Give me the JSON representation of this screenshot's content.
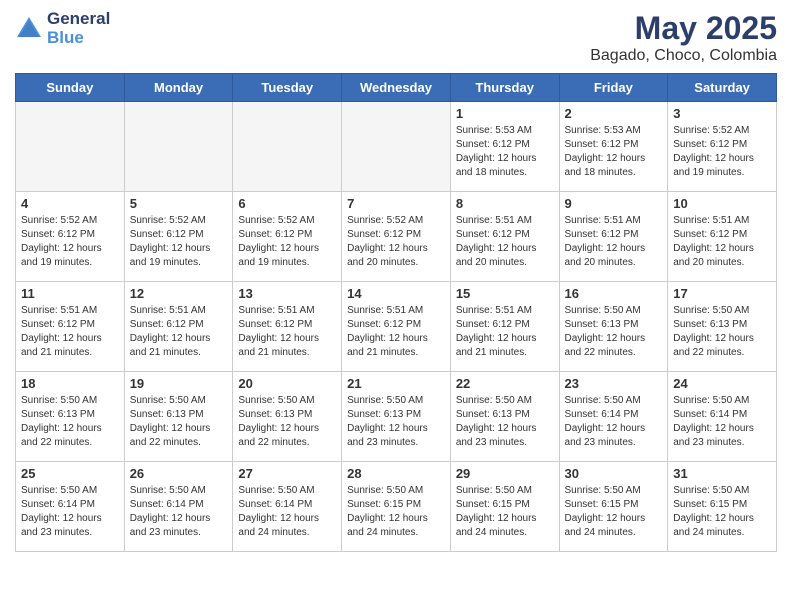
{
  "header": {
    "logo_line1": "General",
    "logo_line2": "Blue",
    "title": "May 2025",
    "subtitle": "Bagado, Choco, Colombia"
  },
  "weekdays": [
    "Sunday",
    "Monday",
    "Tuesday",
    "Wednesday",
    "Thursday",
    "Friday",
    "Saturday"
  ],
  "weeks": [
    [
      {
        "day": "",
        "info": ""
      },
      {
        "day": "",
        "info": ""
      },
      {
        "day": "",
        "info": ""
      },
      {
        "day": "",
        "info": ""
      },
      {
        "day": "1",
        "info": "Sunrise: 5:53 AM\nSunset: 6:12 PM\nDaylight: 12 hours and 18 minutes."
      },
      {
        "day": "2",
        "info": "Sunrise: 5:53 AM\nSunset: 6:12 PM\nDaylight: 12 hours and 18 minutes."
      },
      {
        "day": "3",
        "info": "Sunrise: 5:52 AM\nSunset: 6:12 PM\nDaylight: 12 hours and 19 minutes."
      }
    ],
    [
      {
        "day": "4",
        "info": "Sunrise: 5:52 AM\nSunset: 6:12 PM\nDaylight: 12 hours and 19 minutes."
      },
      {
        "day": "5",
        "info": "Sunrise: 5:52 AM\nSunset: 6:12 PM\nDaylight: 12 hours and 19 minutes."
      },
      {
        "day": "6",
        "info": "Sunrise: 5:52 AM\nSunset: 6:12 PM\nDaylight: 12 hours and 19 minutes."
      },
      {
        "day": "7",
        "info": "Sunrise: 5:52 AM\nSunset: 6:12 PM\nDaylight: 12 hours and 20 minutes."
      },
      {
        "day": "8",
        "info": "Sunrise: 5:51 AM\nSunset: 6:12 PM\nDaylight: 12 hours and 20 minutes."
      },
      {
        "day": "9",
        "info": "Sunrise: 5:51 AM\nSunset: 6:12 PM\nDaylight: 12 hours and 20 minutes."
      },
      {
        "day": "10",
        "info": "Sunrise: 5:51 AM\nSunset: 6:12 PM\nDaylight: 12 hours and 20 minutes."
      }
    ],
    [
      {
        "day": "11",
        "info": "Sunrise: 5:51 AM\nSunset: 6:12 PM\nDaylight: 12 hours and 21 minutes."
      },
      {
        "day": "12",
        "info": "Sunrise: 5:51 AM\nSunset: 6:12 PM\nDaylight: 12 hours and 21 minutes."
      },
      {
        "day": "13",
        "info": "Sunrise: 5:51 AM\nSunset: 6:12 PM\nDaylight: 12 hours and 21 minutes."
      },
      {
        "day": "14",
        "info": "Sunrise: 5:51 AM\nSunset: 6:12 PM\nDaylight: 12 hours and 21 minutes."
      },
      {
        "day": "15",
        "info": "Sunrise: 5:51 AM\nSunset: 6:12 PM\nDaylight: 12 hours and 21 minutes."
      },
      {
        "day": "16",
        "info": "Sunrise: 5:50 AM\nSunset: 6:13 PM\nDaylight: 12 hours and 22 minutes."
      },
      {
        "day": "17",
        "info": "Sunrise: 5:50 AM\nSunset: 6:13 PM\nDaylight: 12 hours and 22 minutes."
      }
    ],
    [
      {
        "day": "18",
        "info": "Sunrise: 5:50 AM\nSunset: 6:13 PM\nDaylight: 12 hours and 22 minutes."
      },
      {
        "day": "19",
        "info": "Sunrise: 5:50 AM\nSunset: 6:13 PM\nDaylight: 12 hours and 22 minutes."
      },
      {
        "day": "20",
        "info": "Sunrise: 5:50 AM\nSunset: 6:13 PM\nDaylight: 12 hours and 22 minutes."
      },
      {
        "day": "21",
        "info": "Sunrise: 5:50 AM\nSunset: 6:13 PM\nDaylight: 12 hours and 23 minutes."
      },
      {
        "day": "22",
        "info": "Sunrise: 5:50 AM\nSunset: 6:13 PM\nDaylight: 12 hours and 23 minutes."
      },
      {
        "day": "23",
        "info": "Sunrise: 5:50 AM\nSunset: 6:14 PM\nDaylight: 12 hours and 23 minutes."
      },
      {
        "day": "24",
        "info": "Sunrise: 5:50 AM\nSunset: 6:14 PM\nDaylight: 12 hours and 23 minutes."
      }
    ],
    [
      {
        "day": "25",
        "info": "Sunrise: 5:50 AM\nSunset: 6:14 PM\nDaylight: 12 hours and 23 minutes."
      },
      {
        "day": "26",
        "info": "Sunrise: 5:50 AM\nSunset: 6:14 PM\nDaylight: 12 hours and 23 minutes."
      },
      {
        "day": "27",
        "info": "Sunrise: 5:50 AM\nSunset: 6:14 PM\nDaylight: 12 hours and 24 minutes."
      },
      {
        "day": "28",
        "info": "Sunrise: 5:50 AM\nSunset: 6:15 PM\nDaylight: 12 hours and 24 minutes."
      },
      {
        "day": "29",
        "info": "Sunrise: 5:50 AM\nSunset: 6:15 PM\nDaylight: 12 hours and 24 minutes."
      },
      {
        "day": "30",
        "info": "Sunrise: 5:50 AM\nSunset: 6:15 PM\nDaylight: 12 hours and 24 minutes."
      },
      {
        "day": "31",
        "info": "Sunrise: 5:50 AM\nSunset: 6:15 PM\nDaylight: 12 hours and 24 minutes."
      }
    ]
  ]
}
